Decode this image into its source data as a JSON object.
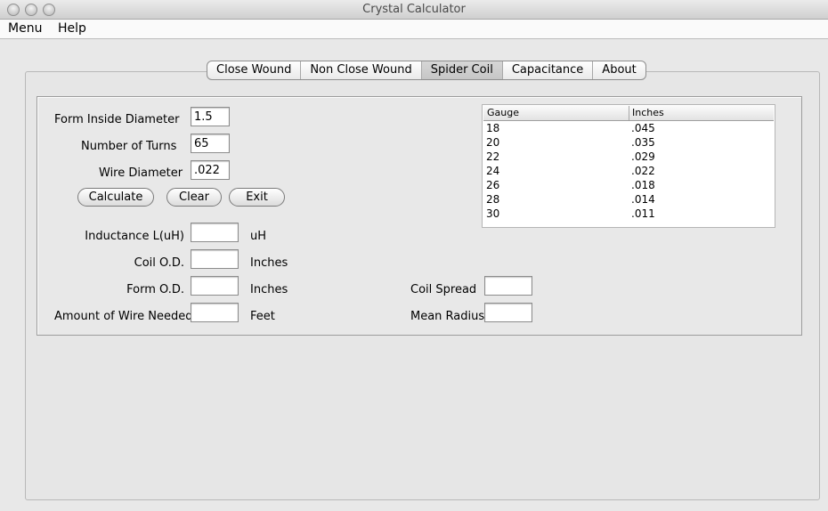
{
  "window": {
    "title": "Crystal Calculator"
  },
  "menubar": {
    "items": [
      "Menu",
      "Help"
    ]
  },
  "tabs": [
    "Close Wound",
    "Non Close Wound",
    "Spider Coil",
    "Capacitance",
    "About"
  ],
  "active_tab": "Spider Coil",
  "inputs": {
    "form_inside_diameter": {
      "label": "Form Inside Diameter",
      "value": "1.5"
    },
    "number_of_turns": {
      "label": "Number of Turns",
      "value": "65"
    },
    "wire_diameter": {
      "label": "Wire Diameter",
      "value": ".022"
    }
  },
  "buttons": {
    "calculate": "Calculate",
    "clear": "Clear",
    "exit": "Exit"
  },
  "outputs": {
    "inductance": {
      "label": "Inductance L(uH)",
      "value": "",
      "unit": "uH"
    },
    "coil_od": {
      "label": "Coil O.D.",
      "value": "",
      "unit": "Inches"
    },
    "form_od": {
      "label": "Form O.D.",
      "value": "",
      "unit": "Inches"
    },
    "wire_needed": {
      "label": "Amount of Wire Needed",
      "value": "",
      "unit": "Feet"
    },
    "coil_spread": {
      "label": "Coil Spread",
      "value": ""
    },
    "mean_radius": {
      "label": "Mean Radius",
      "value": ""
    }
  },
  "gauge_table": {
    "columns": [
      "Gauge",
      "Inches"
    ],
    "rows": [
      [
        "18",
        ".045"
      ],
      [
        "20",
        ".035"
      ],
      [
        "22",
        ".029"
      ],
      [
        "24",
        ".022"
      ],
      [
        "26",
        ".018"
      ],
      [
        "28",
        ".014"
      ],
      [
        "30",
        ".011"
      ]
    ]
  }
}
